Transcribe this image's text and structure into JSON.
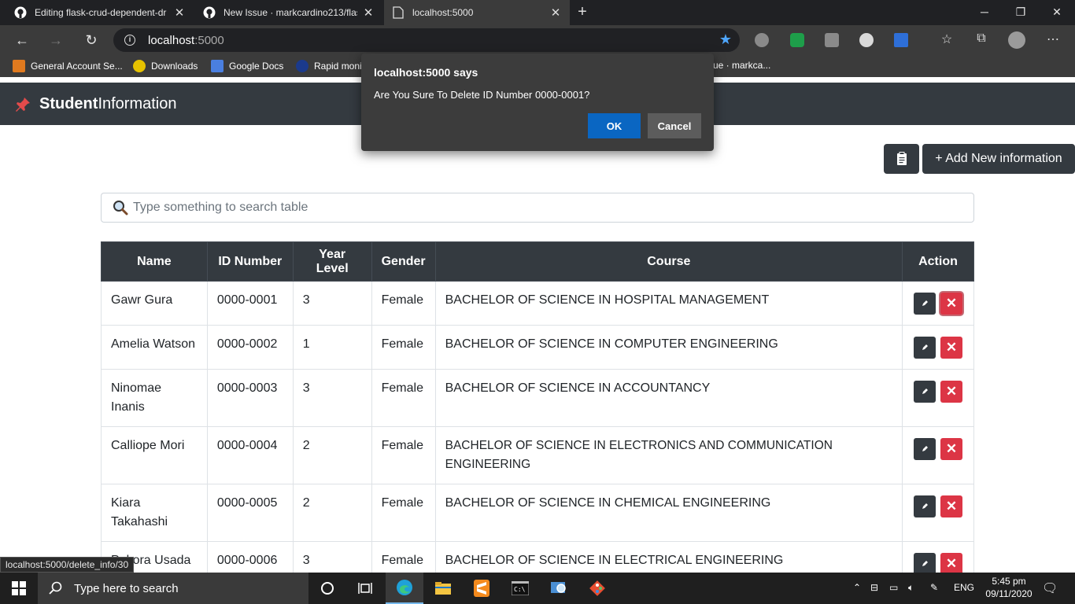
{
  "browser": {
    "tabs": [
      {
        "title": "Editing flask-crud-dependent-dr",
        "icon": "github-icon"
      },
      {
        "title": "New Issue · markcardino213/flas",
        "icon": "github-icon"
      },
      {
        "title": "localhost:5000",
        "icon": "page-icon"
      }
    ],
    "url_host": "localhost",
    "url_port": ":5000",
    "bookmarks": [
      {
        "label": "General Account Se..."
      },
      {
        "label": "Downloads"
      },
      {
        "label": "Google Docs"
      },
      {
        "label": "Rapid moni"
      },
      {
        "label": "ue · markca..."
      }
    ],
    "status_url": "localhost:5000/delete_info/30"
  },
  "page": {
    "brand_bold": "Student",
    "brand_rest": "Information",
    "add_button": "+ Add New information",
    "search_placeholder": "Type something to search table",
    "table": {
      "headers": [
        "Name",
        "ID Number",
        "Year Level",
        "Gender",
        "Course",
        "Action"
      ],
      "rows": [
        {
          "name": "Gawr Gura",
          "id": "0000-0001",
          "year": "3",
          "gender": "Female",
          "course": "BACHELOR OF SCIENCE IN HOSPITAL MANAGEMENT"
        },
        {
          "name": "Amelia Watson",
          "id": "0000-0002",
          "year": "1",
          "gender": "Female",
          "course": "BACHELOR OF SCIENCE IN COMPUTER ENGINEERING"
        },
        {
          "name": "Ninomae Inanis",
          "id": "0000-0003",
          "year": "3",
          "gender": "Female",
          "course": "BACHELOR OF SCIENCE IN ACCOUNTANCY"
        },
        {
          "name": "Calliope Mori",
          "id": "0000-0004",
          "year": "2",
          "gender": "Female",
          "course": "BACHELOR OF SCIENCE IN ELECTRONICS AND COMMUNICATION ENGINEERING"
        },
        {
          "name": "Kiara Takahashi",
          "id": "0000-0005",
          "year": "2",
          "gender": "Female",
          "course": "BACHELOR OF SCIENCE IN CHEMICAL ENGINEERING"
        },
        {
          "name": "Pekora Usada",
          "id": "0000-0006",
          "year": "3",
          "gender": "Female",
          "course": "BACHELOR OF SCIENCE IN ELECTRICAL ENGINEERING"
        }
      ]
    }
  },
  "dialog": {
    "title": "localhost:5000 says",
    "message": "Are You Sure To Delete ID Number 0000-0001?",
    "ok": "OK",
    "cancel": "Cancel"
  },
  "taskbar": {
    "search_placeholder": "Type here to search",
    "lang": "ENG",
    "time": "5:45 pm",
    "date": "09/11/2020"
  },
  "colors": {
    "navbar": "#343a40",
    "danger": "#dc3545",
    "dialog_ok": "#0a66c2"
  }
}
